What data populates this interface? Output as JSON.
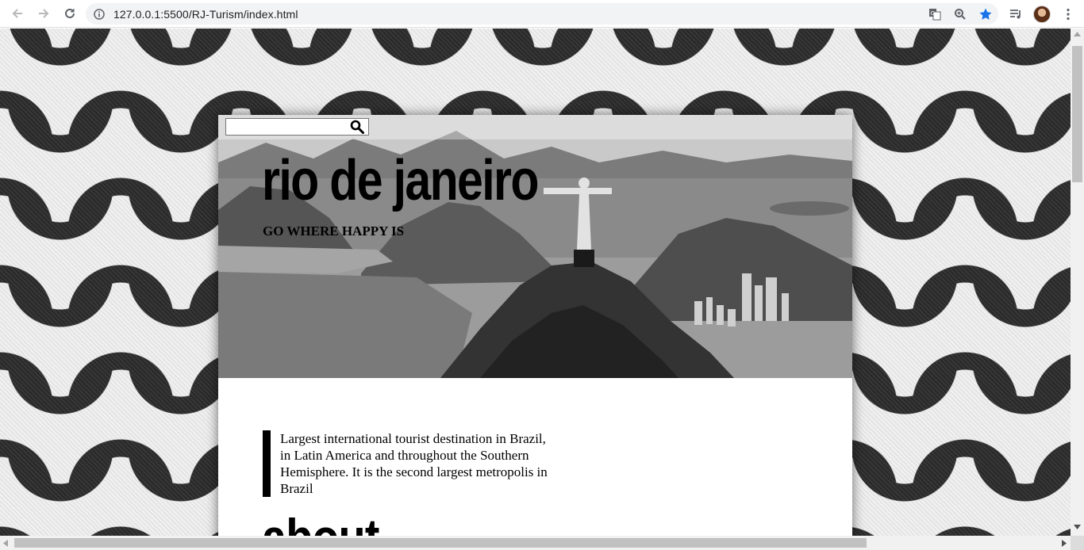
{
  "browser": {
    "url": "127.0.0.1:5500/RJ-Turism/index.html",
    "icons": [
      "back-arrow-icon",
      "forward-arrow-icon",
      "reload-icon",
      "info-icon",
      "translate-icon",
      "zoom-icon",
      "bookmark-star-icon",
      "media-playlist-icon",
      "profile-avatar",
      "more-vert-icon"
    ],
    "accent_color": "#1a73e8"
  },
  "page": {
    "search": {
      "value": "",
      "placeholder": ""
    },
    "hero": {
      "title": "rio de janeiro",
      "tagline": "GO WHERE HAPPY IS"
    },
    "intro": {
      "text": "Largest international tourist destination in Brazil, in Latin America and throughout the Southern Hemisphere. It is the second largest metropolis in Brazil"
    },
    "section_heading": "about"
  },
  "colors": {
    "pattern_dark": "#2b2b2b",
    "pattern_light": "#f0f0f0",
    "text": "#000000"
  }
}
